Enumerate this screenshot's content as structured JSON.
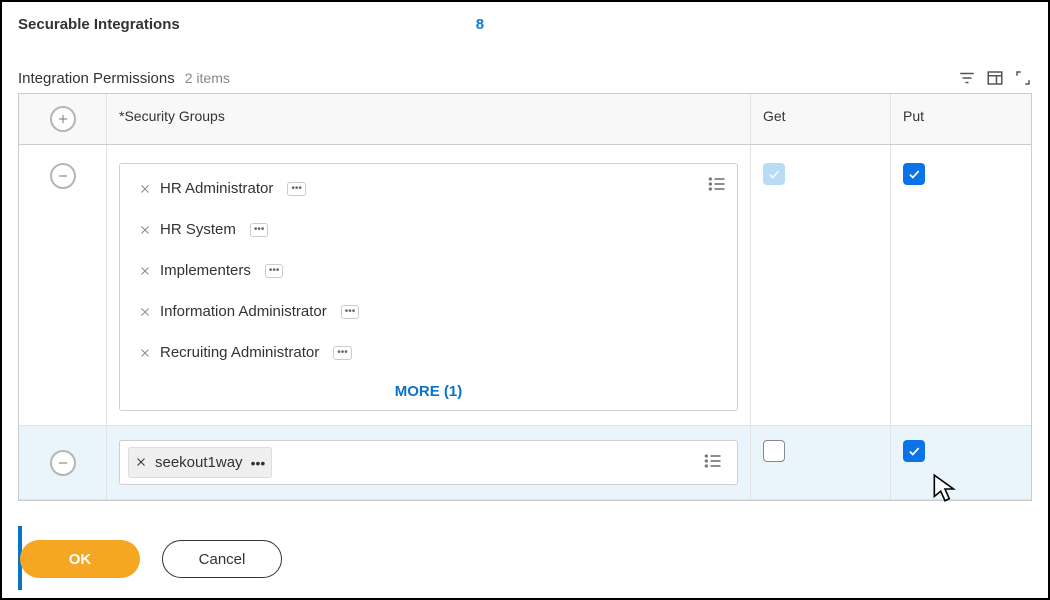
{
  "header": {
    "label": "Securable Integrations",
    "count": "8"
  },
  "subhead": {
    "label": "Integration Permissions",
    "items": "2 items"
  },
  "columns": {
    "security_groups": "*Security Groups",
    "get": "Get",
    "put": "Put"
  },
  "rows": [
    {
      "tokens": [
        {
          "label": "HR Administrator"
        },
        {
          "label": "HR System"
        },
        {
          "label": "Implementers"
        },
        {
          "label": "Information Administrator"
        },
        {
          "label": "Recruiting Administrator"
        }
      ],
      "more_label": "MORE (1)",
      "get": "checked-soft",
      "put": "checked"
    },
    {
      "tokens": [
        {
          "label": "seekout1way"
        }
      ],
      "get": "empty",
      "put": "checked"
    }
  ],
  "footer": {
    "ok": "OK",
    "cancel": "Cancel"
  }
}
